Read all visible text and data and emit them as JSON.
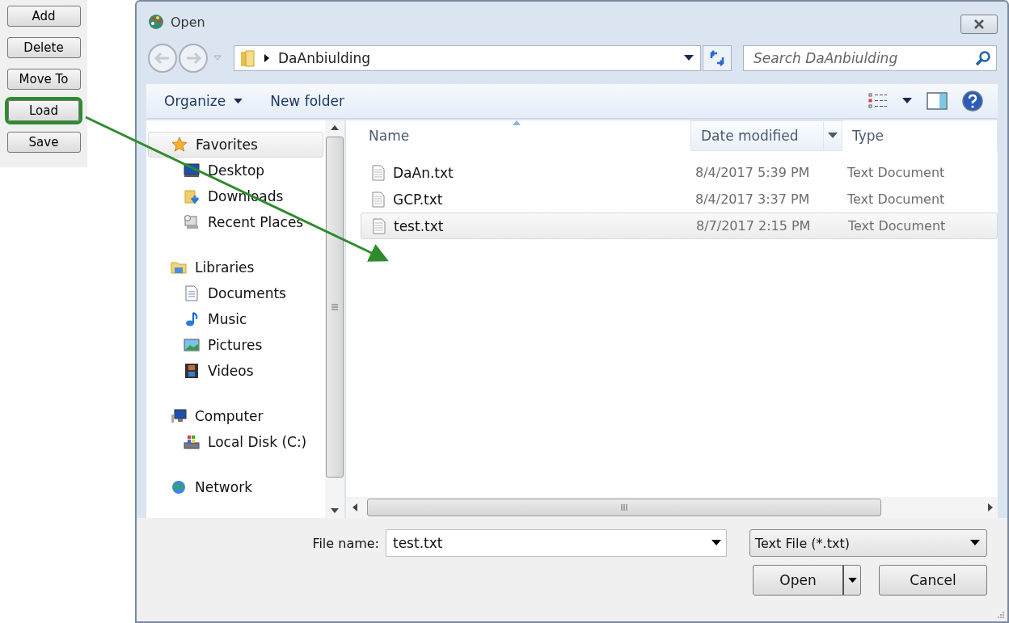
{
  "side_buttons": [
    {
      "label": "Add",
      "highlighted": false
    },
    {
      "label": "Delete",
      "highlighted": false
    },
    {
      "label": "Move To",
      "highlighted": false
    },
    {
      "label": "Load",
      "highlighted": true
    },
    {
      "label": "Save",
      "highlighted": false
    }
  ],
  "window": {
    "title": "Open"
  },
  "address": {
    "path": "DaAnbiulding"
  },
  "search": {
    "placeholder": "Search DaAnbiulding"
  },
  "toolbar": {
    "organize": "Organize",
    "new_folder": "New folder"
  },
  "nav": [
    {
      "label": "Favorites",
      "kind": "favorites",
      "selected": true,
      "children": [
        {
          "label": "Desktop",
          "kind": "desktop",
          "selected": false
        },
        {
          "label": "Downloads",
          "kind": "downloads",
          "selected": false
        },
        {
          "label": "Recent Places",
          "kind": "recent",
          "selected": false
        }
      ]
    },
    {
      "label": "Libraries",
      "kind": "libraries",
      "selected": false,
      "children": [
        {
          "label": "Documents",
          "kind": "documents",
          "selected": false
        },
        {
          "label": "Music",
          "kind": "music",
          "selected": false
        },
        {
          "label": "Pictures",
          "kind": "pictures",
          "selected": false
        },
        {
          "label": "Videos",
          "kind": "videos",
          "selected": false
        }
      ]
    },
    {
      "label": "Computer",
      "kind": "computer",
      "selected": false,
      "children": [
        {
          "label": "Local Disk (C:)",
          "kind": "disk",
          "selected": false
        }
      ]
    },
    {
      "label": "Network",
      "kind": "network",
      "selected": false
    }
  ],
  "columns": [
    {
      "label": "Name",
      "sorted": true,
      "highlighted": false
    },
    {
      "label": "Date modified",
      "sorted": false,
      "highlighted": true
    },
    {
      "label": "Type",
      "sorted": false,
      "highlighted": false
    }
  ],
  "files": [
    {
      "name": "DaAn.txt",
      "date": "8/4/2017 5:39 PM",
      "type": "Text Document",
      "selected": false
    },
    {
      "name": "GCP.txt",
      "date": "8/4/2017 3:37 PM",
      "type": "Text Document",
      "selected": false
    },
    {
      "name": "test.txt",
      "date": "8/7/2017 2:15 PM",
      "type": "Text Document",
      "selected": true
    }
  ],
  "file_name": {
    "label": "File name:",
    "value": "test.txt"
  },
  "file_type": {
    "value": "Text File (*.txt)"
  },
  "buttons": [
    {
      "label": "Open",
      "kind": "split"
    },
    {
      "label": "Cancel",
      "kind": "plain"
    }
  ]
}
